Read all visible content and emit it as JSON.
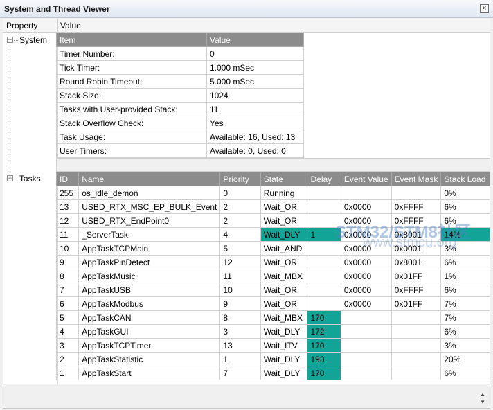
{
  "window": {
    "title": "System and Thread Viewer"
  },
  "columns": {
    "property": "Property",
    "value": "Value"
  },
  "tree": {
    "system": "System",
    "tasks": "Tasks"
  },
  "system_table": {
    "headers": [
      "Item",
      "Value"
    ],
    "rows": [
      [
        "Timer Number:",
        "0"
      ],
      [
        "Tick Timer:",
        "1.000 mSec"
      ],
      [
        "Round Robin Timeout:",
        "5.000 mSec"
      ],
      [
        "Stack Size:",
        "1024"
      ],
      [
        "Tasks with User-provided Stack:",
        "11"
      ],
      [
        "Stack Overflow Check:",
        "Yes"
      ],
      [
        "Task Usage:",
        "Available: 16, Used: 13"
      ],
      [
        "User Timers:",
        "Available: 0, Used: 0"
      ]
    ]
  },
  "task_table": {
    "headers": [
      "ID",
      "Name",
      "Priority",
      "State",
      "Delay",
      "Event Value",
      "Event Mask",
      "Stack Load"
    ],
    "rows": [
      [
        "255",
        "os_idle_demon",
        "0",
        "Running",
        "",
        "",
        "",
        "0%"
      ],
      [
        "13",
        "USBD_RTX_MSC_EP_BULK_Event",
        "2",
        "Wait_OR",
        "",
        "0x0000",
        "0xFFFF",
        "6%"
      ],
      [
        "12",
        "USBD_RTX_EndPoint0",
        "2",
        "Wait_OR",
        "",
        "0x0000",
        "0xFFFF",
        "6%"
      ],
      [
        "11",
        "_ServerTask",
        "4",
        "Wait_DLY",
        "1",
        "0x0000",
        "0x8001",
        "14%"
      ],
      [
        "10",
        "AppTaskTCPMain",
        "5",
        "Wait_AND",
        "",
        "0x0000",
        "0x0001",
        "3%"
      ],
      [
        "9",
        "AppTaskPinDetect",
        "12",
        "Wait_OR",
        "",
        "0x0000",
        "0x8001",
        "6%"
      ],
      [
        "8",
        "AppTaskMusic",
        "11",
        "Wait_MBX",
        "",
        "0x0000",
        "0x01FF",
        "1%"
      ],
      [
        "7",
        "AppTaskUSB",
        "10",
        "Wait_OR",
        "",
        "0x0000",
        "0xFFFF",
        "6%"
      ],
      [
        "6",
        "AppTaskModbus",
        "9",
        "Wait_OR",
        "",
        "0x0000",
        "0x01FF",
        "7%"
      ],
      [
        "5",
        "AppTaskCAN",
        "8",
        "Wait_MBX",
        "170",
        "",
        "",
        "7%"
      ],
      [
        "4",
        "AppTaskGUI",
        "3",
        "Wait_DLY",
        "172",
        "",
        "",
        "6%"
      ],
      [
        "3",
        "AppTaskTCPTimer",
        "13",
        "Wait_ITV",
        "170",
        "",
        "",
        "3%"
      ],
      [
        "2",
        "AppTaskStatistic",
        "1",
        "Wait_DLY",
        "193",
        "",
        "",
        "20%"
      ],
      [
        "1",
        "AppTaskStart",
        "7",
        "Wait_DLY",
        "170",
        "",
        "",
        "6%"
      ]
    ],
    "highlight_color": "#12a597"
  },
  "watermark": {
    "line1": "STM32/STM8社区",
    "line2": "www.stmcu.org"
  }
}
